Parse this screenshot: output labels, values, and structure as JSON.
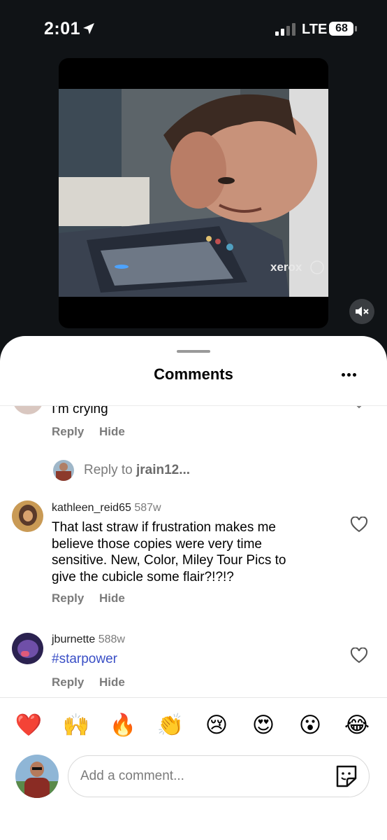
{
  "status_bar": {
    "time": "2:01",
    "network": "LTE",
    "battery": "68"
  },
  "video": {
    "watermark": "xerox"
  },
  "sheet": {
    "title": "Comments"
  },
  "comments": [
    {
      "text": "I'm crying",
      "reply_label": "Reply",
      "hide_label": "Hide"
    },
    {
      "reply_to_prefix": "Reply to ",
      "reply_to_user": "jrain12..."
    },
    {
      "username": "kathleen_reid65",
      "time": "587w",
      "lines": [
        "That last straw if frustration makes me",
        "believe those copies were very time",
        "sensitive. New, Color, Miley Tour Pics to",
        "give the cubicle some flair?!?!?"
      ],
      "reply_label": "Reply",
      "hide_label": "Hide"
    },
    {
      "username": "jburnette",
      "time": "588w",
      "text": "#starpower",
      "reply_label": "Reply",
      "hide_label": "Hide"
    }
  ],
  "emoji_bar": [
    "❤️",
    "🙌",
    "🔥",
    "👏",
    "😢",
    "😍",
    "😮",
    "😂"
  ],
  "composer": {
    "placeholder": "Add a comment..."
  },
  "icons": {
    "location": "location-arrow-icon",
    "signal": "cellular-signal-icon",
    "battery": "battery-icon",
    "mute": "speaker-muted-icon",
    "more": "more-horizontal-icon",
    "like": "heart-outline-icon",
    "sticker": "sticker-icon"
  },
  "colors": {
    "background": "#101316",
    "hashtag": "#3a4fc6",
    "secondary_text": "#7b7b7b"
  }
}
